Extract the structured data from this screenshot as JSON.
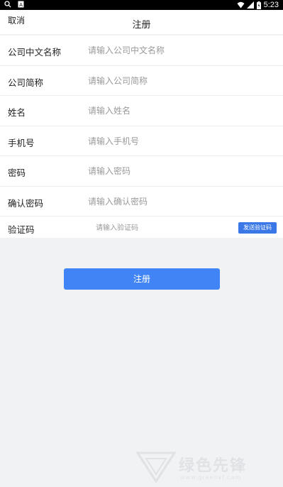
{
  "status_bar": {
    "left_icons": [
      "search-icon",
      "a-icon"
    ],
    "right_icons": [
      "wifi-icon",
      "signal-icon",
      "battery-icon"
    ],
    "time": "5:23"
  },
  "header": {
    "cancel_label": "取消",
    "title": "注册"
  },
  "form": {
    "fields": [
      {
        "label": "公司中文名称",
        "placeholder": "请输入公司中文名称",
        "value": ""
      },
      {
        "label": "公司简称",
        "placeholder": "请输入公司简称",
        "value": ""
      },
      {
        "label": "姓名",
        "placeholder": "请输入姓名",
        "value": ""
      },
      {
        "label": "手机号",
        "placeholder": "请输入手机号",
        "value": ""
      },
      {
        "label": "密码",
        "placeholder": "请输入密码",
        "value": ""
      },
      {
        "label": "确认密码",
        "placeholder": "请输入确认密码",
        "value": ""
      }
    ],
    "code": {
      "label": "验证码",
      "placeholder": "请输入验证码",
      "value": "",
      "send_label": "发送验证码"
    }
  },
  "register_button": {
    "label": "注册"
  },
  "colors": {
    "accent": "#4084f5",
    "send_button": "#3a78e8",
    "background": "#f1f2f4"
  },
  "watermark": {
    "text": "绿色先锋",
    "sub": "www.greenxf.com"
  }
}
